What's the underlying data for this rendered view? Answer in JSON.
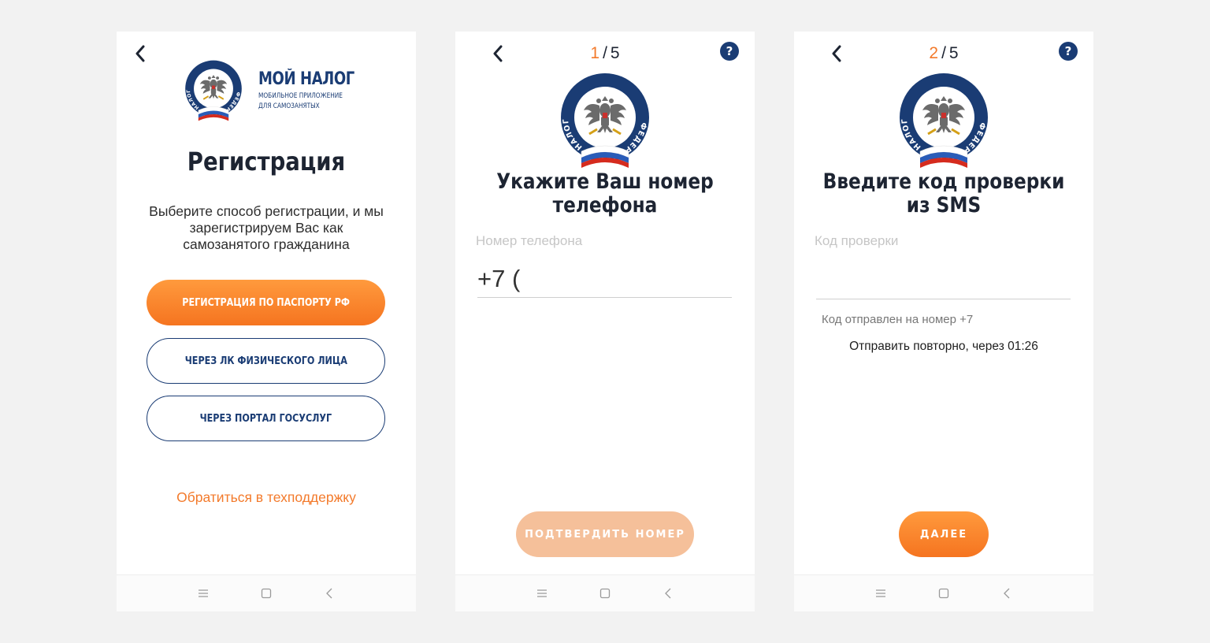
{
  "colors": {
    "accent": "#f37a2b",
    "brand_blue": "#1a3c74",
    "disabled_button": "#f5c09a",
    "background": "#f2f2f2"
  },
  "screen1": {
    "brand_name": "МОЙ НАЛОГ",
    "brand_sub_line1": "МОБИЛЬНОЕ ПРИЛОЖЕНИЕ",
    "brand_sub_line2": "ДЛЯ САМОЗАНЯТЫХ",
    "title": "Регистрация",
    "description": "Выберите способ регистрации, и мы зарегистрируем Вас как самозанятого гражданина",
    "btn_passport": "РЕГИСТРАЦИЯ ПО ПАСПОРТУ РФ",
    "btn_lk": "ЧЕРЕЗ ЛК ФИЗИЧЕСКОГО ЛИЦА",
    "btn_gosuslugi": "ЧЕРЕЗ ПОРТАЛ ГОСУСЛУГ",
    "support_link": "Обратиться в техподдержку"
  },
  "screen2": {
    "step_current": "1",
    "step_total": "5",
    "title": "Укажите Ваш номер телефона",
    "field_label": "Номер телефона",
    "phone_value": "+7 (",
    "confirm_button": "ПОДТВЕРДИТЬ НОМЕР",
    "confirm_enabled": false
  },
  "screen3": {
    "step_current": "2",
    "step_total": "5",
    "title": "Введите код проверки из SMS",
    "field_label": "Код проверки",
    "code_value": "",
    "sent_info": "Код отправлен на номер +7",
    "resend_text": "Отправить повторно, через 01:26",
    "next_button": "ДАЛЕЕ"
  },
  "emblem_text": "ФЕДЕРАЛЬНАЯ НАЛОГОВАЯ СЛУЖБА",
  "icons": {
    "back": "chevron-left-icon",
    "help": "question-icon",
    "nav_menu": "menu-icon",
    "nav_home": "square-icon",
    "nav_back": "triangle-back-icon"
  },
  "help_glyph": "?",
  "step_separator": "/"
}
